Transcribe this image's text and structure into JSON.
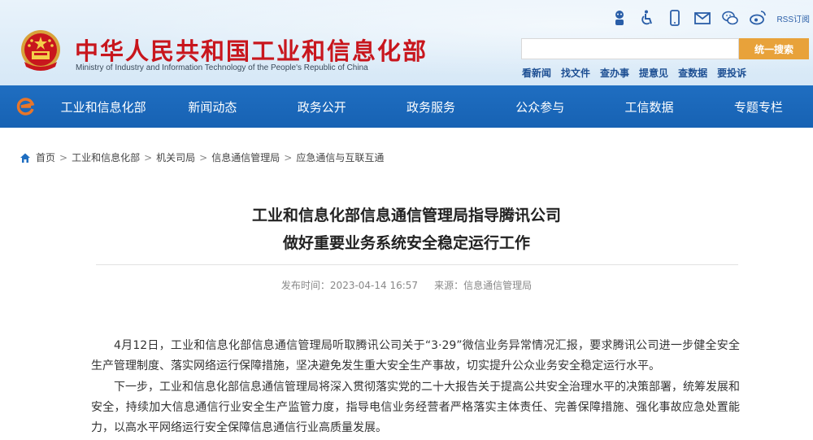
{
  "header": {
    "title_cn": "中华人民共和国工业和信息化部",
    "title_en": "Ministry of Industry and Information Technology of the People's Republic of China",
    "icons": [
      "robot-icon",
      "accessibility-icon",
      "mobile-icon",
      "mail-icon",
      "wechat-icon",
      "weibo-icon"
    ],
    "rss_label": "RSS订阅",
    "search_placeholder": "",
    "search_button": "统一搜索",
    "quick_links": [
      "看新闻",
      "找文件",
      "查办事",
      "提意见",
      "查数据",
      "要投诉"
    ]
  },
  "nav": {
    "items": [
      "工业和信息化部",
      "新闻动态",
      "政务公开",
      "政务服务",
      "公众参与",
      "工信数据",
      "专题专栏"
    ]
  },
  "breadcrumb": [
    "首页",
    "工业和信息化部",
    "机关司局",
    "信息通信管理局",
    "应急通信与互联互通"
  ],
  "article": {
    "title_line1": "工业和信息化部信息通信管理局指导腾讯公司",
    "title_line2": "做好重要业务系统安全稳定运行工作",
    "publish_time": "发布时间：2023-04-14 16:57",
    "source": "来源：信息通信管理局",
    "paragraphs": [
      "4月12日，工业和信息化部信息通信管理局听取腾讯公司关于“3·29”微信业务异常情况汇报，要求腾讯公司进一步健全安全生产管理制度、落实网络运行保障措施，坚决避免发生重大安全生产事故，切实提升公众业务安全稳定运行水平。",
      "下一步，工业和信息化部信息通信管理局将深入贯彻落实党的二十大报告关于提高公共安全治理水平的决策部署，统筹发展和安全，持续加大信息通信行业安全生产监管力度，指导电信业务经营者严格落实主体责任、完善保障措施、强化事故应急处置能力，以高水平网络运行安全保障信息通信行业高质量发展。"
    ]
  },
  "colors": {
    "title_red": "#c8161d",
    "nav_blue": "#1f6ec1",
    "search_orange": "#e8a23a",
    "link_blue": "#1d4f93"
  }
}
